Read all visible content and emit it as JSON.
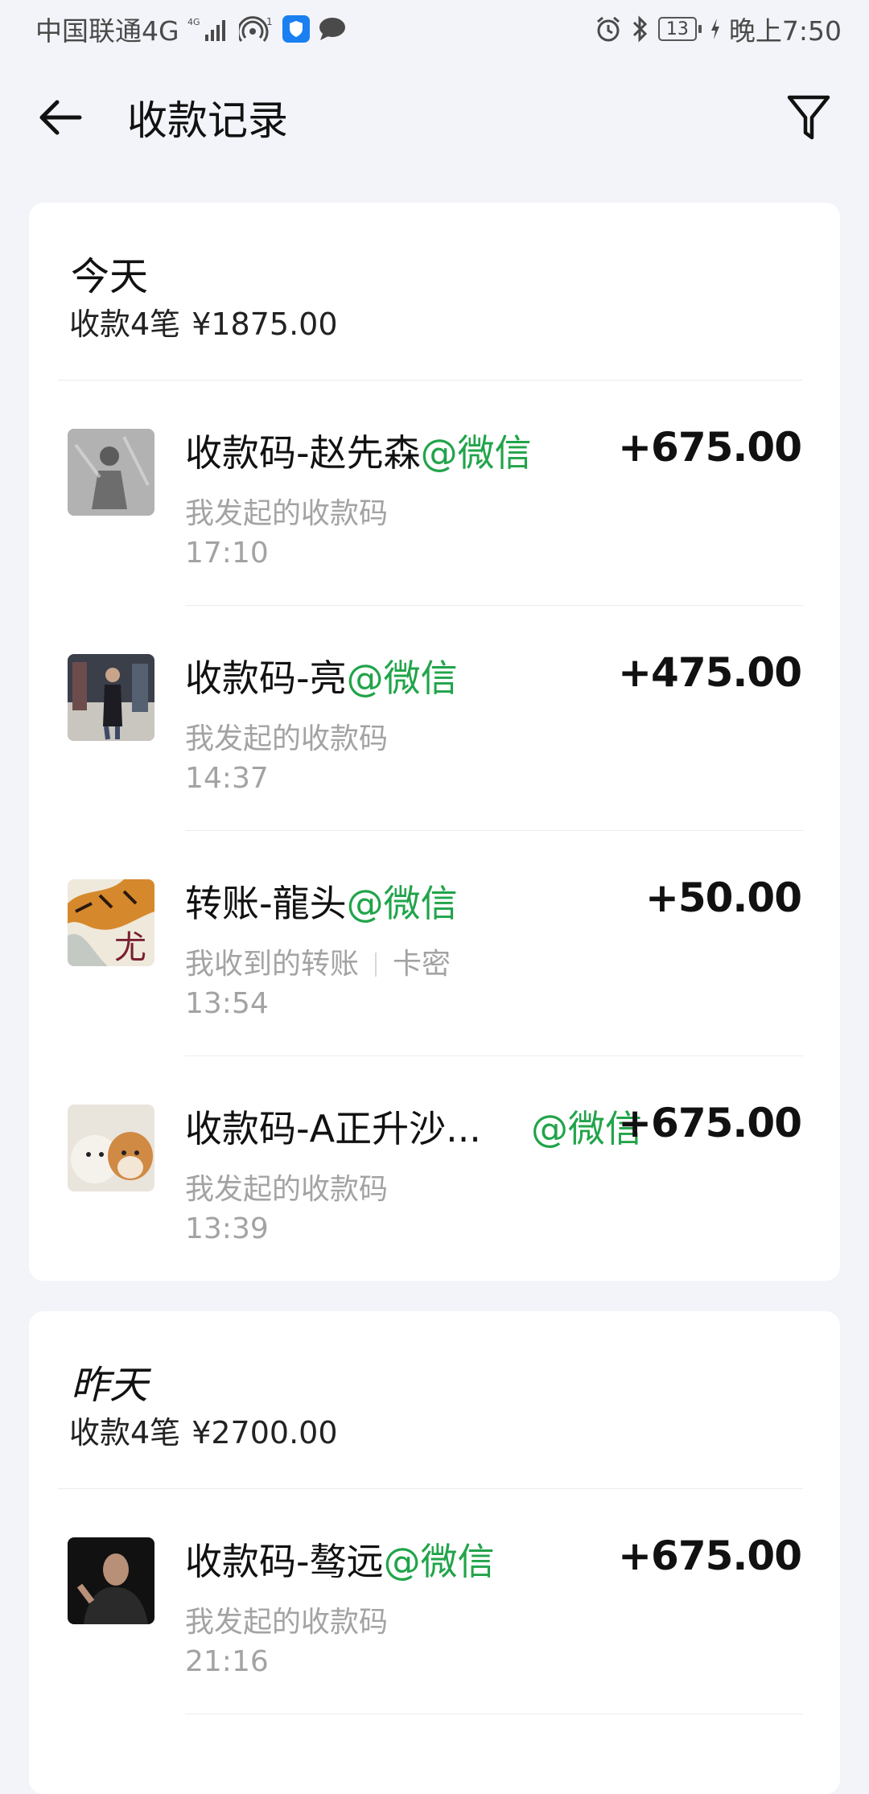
{
  "status_bar": {
    "carrier": "中国联通4G",
    "network_tag": "4G",
    "hotspot_count": "1",
    "battery": "13",
    "time": "晚上7:50"
  },
  "header": {
    "title": "收款记录"
  },
  "sections": [
    {
      "day": "今天",
      "summary_count": "收款4笔",
      "summary_total": "¥1875.00",
      "transactions": [
        {
          "title": "收款码-赵先森",
          "channel": "@微信",
          "subtitle": "我发起的收款码",
          "time": "17:10",
          "amount": "+675.00"
        },
        {
          "title": "收款码-亮",
          "channel": "@微信",
          "subtitle": "我发起的收款码",
          "time": "14:37",
          "amount": "+475.00"
        },
        {
          "title": "转账-龍头",
          "channel": "@微信",
          "subtitle": "我收到的转账",
          "subtitle_extra": "卡密",
          "time": "13:54",
          "amount": "+50.00"
        },
        {
          "title": "收款码-A正升沙...",
          "channel": "@微信",
          "subtitle": "我发起的收款码",
          "time": "13:39",
          "amount": "+675.00"
        }
      ]
    },
    {
      "day": "昨天",
      "summary_count": "收款4笔",
      "summary_total": "¥2700.00",
      "transactions": [
        {
          "title": "收款码-骜远",
          "channel": "@微信",
          "subtitle": "我发起的收款码",
          "time": "21:16",
          "amount": "+675.00"
        }
      ]
    }
  ],
  "colors": {
    "background": "#f3f4f9",
    "channel_green": "#21a44a",
    "muted_text": "#a3a3a3"
  },
  "icons": [
    "back-arrow-icon",
    "filter-icon",
    "signal-icon",
    "hotspot-icon",
    "shield-icon",
    "message-icon",
    "alarm-icon",
    "bluetooth-icon",
    "battery-icon",
    "charging-icon"
  ]
}
